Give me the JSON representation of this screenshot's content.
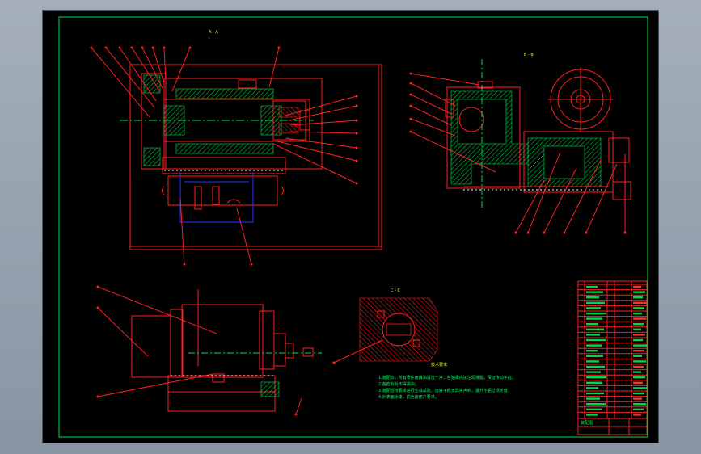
{
  "view_labels": {
    "section_a": "A - A",
    "section_b": "B - B",
    "section_c": "C - C"
  },
  "tech_requirements": {
    "title": "技术要求",
    "lines": [
      "1.装配前，所有零件用煤油清洗干净；各轴承内加注润滑脂，保证传动平稳；",
      "2.各密封处不得漏油；",
      "3.装配后按要求进行空载试验，运转平稳无异常声响，温升不超过规定值；",
      "4.外表面涂漆，颜色按用户要求。"
    ]
  },
  "title_block": {
    "drawing_name": "装配图"
  },
  "colors": {
    "frame": "#00e04a",
    "geometry": "#ff2020",
    "hatch": "#00e04a",
    "hidden": "#2a35ff"
  }
}
